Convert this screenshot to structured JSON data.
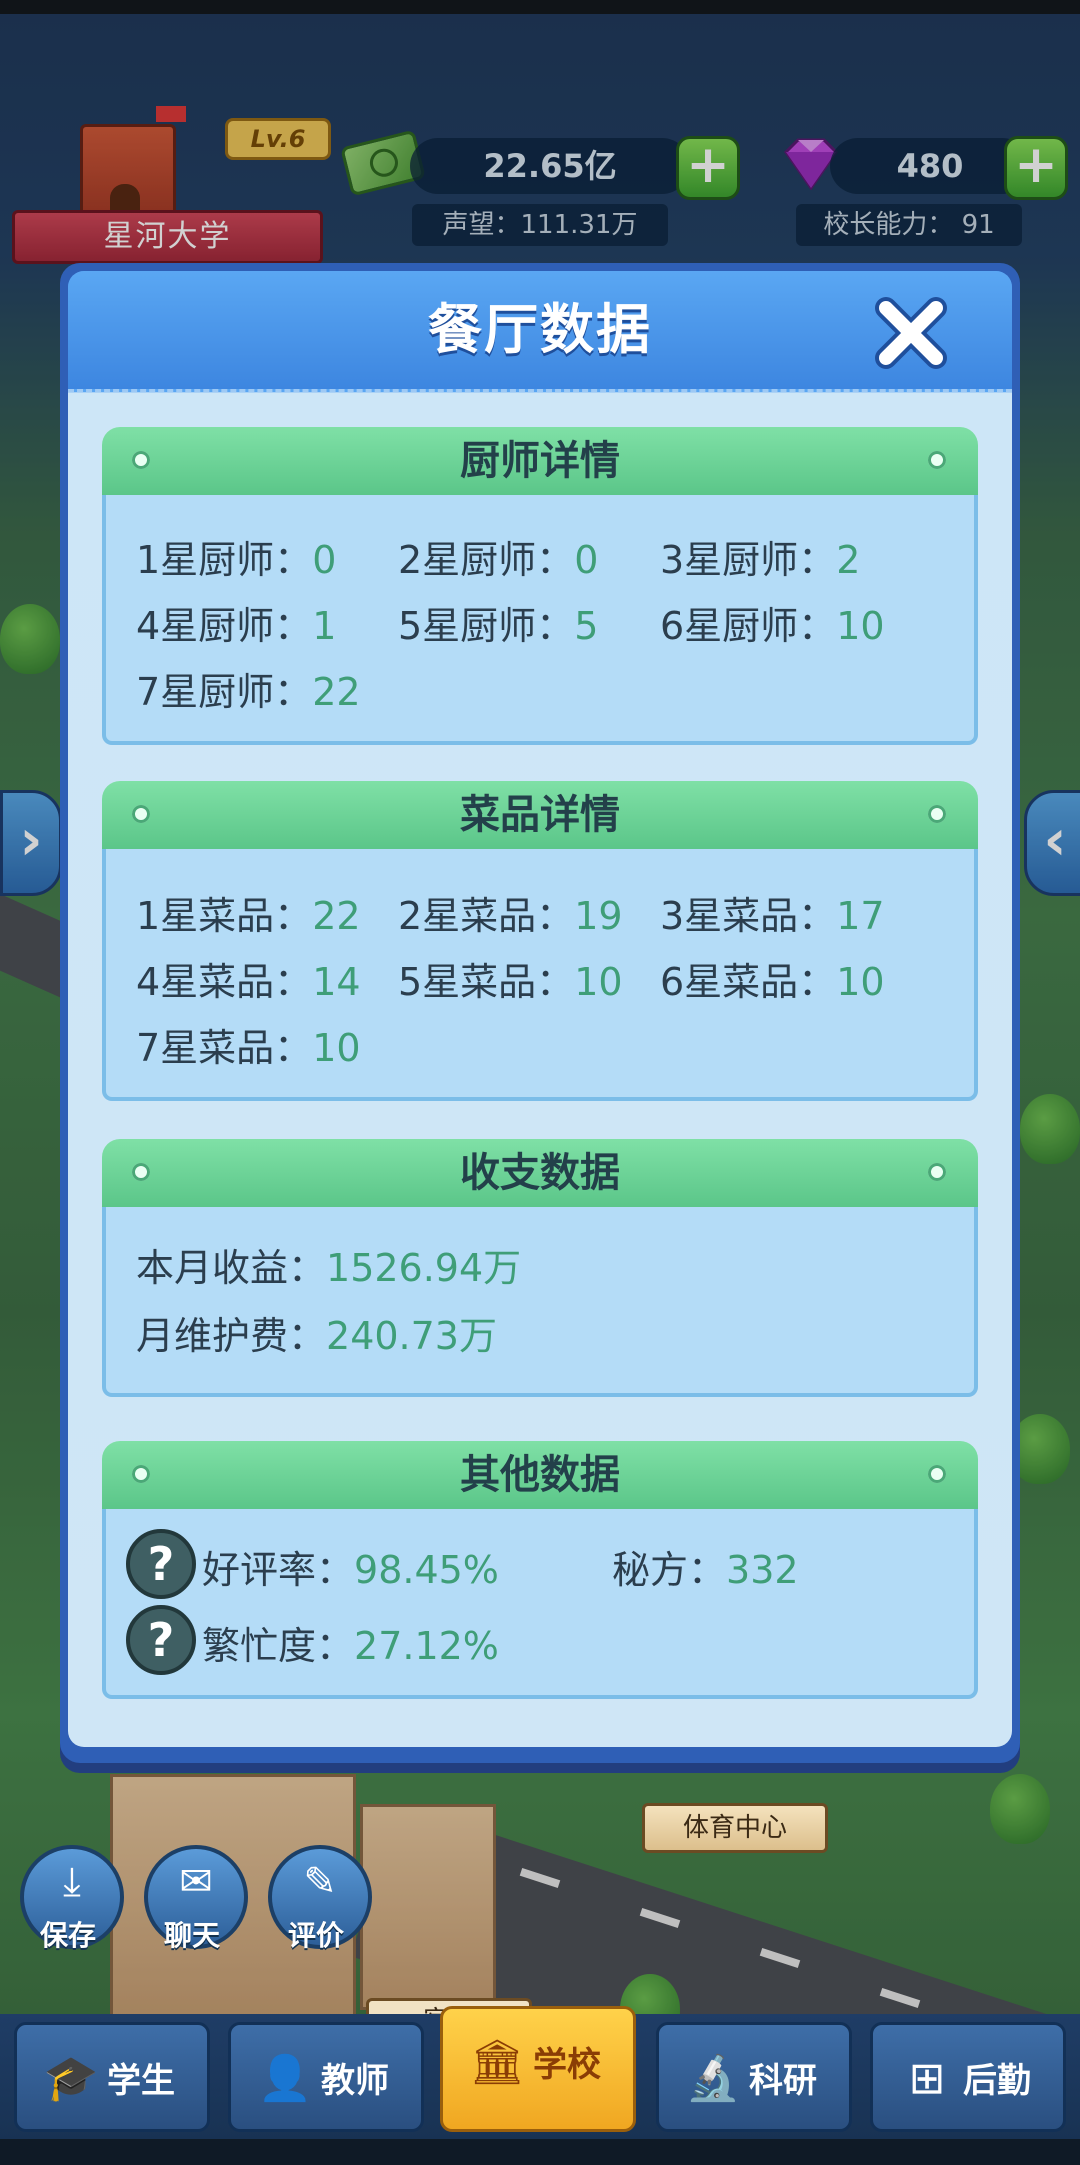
{
  "header": {
    "level": "Lv.6",
    "school_name": "星河大学",
    "money": "22.65亿",
    "gems": "480",
    "reputation": "声望：111.31万",
    "principal_ability": "校长能力：  91"
  },
  "dialog": {
    "title": "餐厅数据",
    "chefs": {
      "title": "厨师详情",
      "items": [
        {
          "label": "1星厨师：",
          "value": "0"
        },
        {
          "label": "2星厨师：",
          "value": "0"
        },
        {
          "label": "3星厨师：",
          "value": "2"
        },
        {
          "label": "4星厨师：",
          "value": "1"
        },
        {
          "label": "5星厨师：",
          "value": "5"
        },
        {
          "label": "6星厨师：",
          "value": "10"
        },
        {
          "label": "7星厨师：",
          "value": "22"
        }
      ]
    },
    "dishes": {
      "title": "菜品详情",
      "items": [
        {
          "label": "1星菜品：",
          "value": "22"
        },
        {
          "label": "2星菜品：",
          "value": "19"
        },
        {
          "label": "3星菜品：",
          "value": "17"
        },
        {
          "label": "4星菜品：",
          "value": "14"
        },
        {
          "label": "5星菜品：",
          "value": "10"
        },
        {
          "label": "6星菜品：",
          "value": "10"
        },
        {
          "label": "7星菜品：",
          "value": "10"
        }
      ]
    },
    "finance": {
      "title": "收支数据",
      "items": [
        {
          "label": "本月收益：",
          "value": "1526.94万"
        },
        {
          "label": "月维护费：",
          "value": "240.73万"
        }
      ]
    },
    "other": {
      "title": "其他数据",
      "rating": {
        "label": "好评率：",
        "value": "98.45%"
      },
      "recipes": {
        "label": "秘方：",
        "value": "332"
      },
      "busyness": {
        "label": "繁忙度：",
        "value": "27.12%"
      }
    }
  },
  "map": {
    "sports_center": "体育中心",
    "dorm": "宿舍"
  },
  "side_buttons": {
    "save": "保存",
    "chat": "聊天",
    "review": "评价"
  },
  "tabs": [
    {
      "label": "学生"
    },
    {
      "label": "教师"
    },
    {
      "label": "学校"
    },
    {
      "label": "科研"
    },
    {
      "label": "后勤"
    }
  ]
}
